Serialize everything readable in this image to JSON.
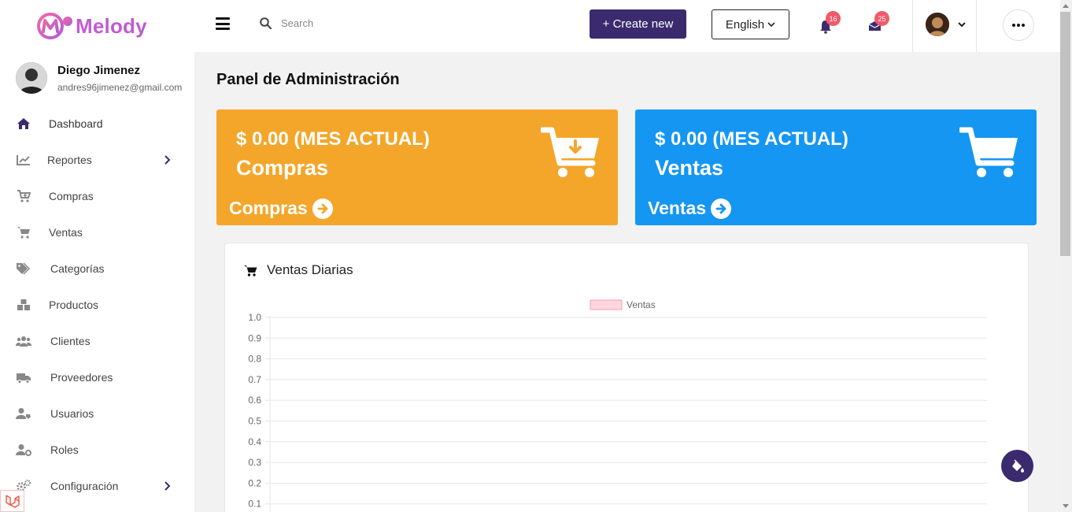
{
  "brand": {
    "name": "Melody"
  },
  "user": {
    "name": "Diego Jimenez",
    "email": "andres96jimenez@gmail.com"
  },
  "sidebar": {
    "items": [
      {
        "label": "Dashboard",
        "icon": "home-icon",
        "submenu": false,
        "active": true
      },
      {
        "label": "Reportes",
        "icon": "chart-line-icon",
        "submenu": true
      },
      {
        "label": "Compras",
        "icon": "cart-plus-icon",
        "submenu": false
      },
      {
        "label": "Ventas",
        "icon": "cart-icon",
        "submenu": false
      },
      {
        "label": "Categorías",
        "icon": "tags-icon",
        "submenu": false
      },
      {
        "label": "Productos",
        "icon": "boxes-icon",
        "submenu": false
      },
      {
        "label": "Clientes",
        "icon": "users-icon",
        "submenu": false
      },
      {
        "label": "Proveedores",
        "icon": "truck-icon",
        "submenu": false
      },
      {
        "label": "Usuarios",
        "icon": "user-tag-icon",
        "submenu": false
      },
      {
        "label": "Roles",
        "icon": "user-cog-icon",
        "submenu": false
      },
      {
        "label": "Configuración",
        "icon": "cogs-icon",
        "submenu": true
      }
    ]
  },
  "topbar": {
    "search_placeholder": "Search",
    "create_label": "+ Create new",
    "language": "English",
    "notifications_count": "16",
    "messages_count": "25"
  },
  "main": {
    "title": "Panel de Administración",
    "cards": [
      {
        "amount": "$ 0.00 (MES ACTUAL)",
        "title": "Compras",
        "link": "Compras",
        "color": "#f4a62a",
        "icon": "cart-download-icon"
      },
      {
        "amount": "$ 0.00 (MES ACTUAL)",
        "title": "Ventas",
        "link": "Ventas",
        "color": "#1496f2",
        "icon": "cart-icon"
      }
    ],
    "panel_title": "Ventas Diarias"
  },
  "chart_data": {
    "type": "bar",
    "title": "",
    "series": [
      {
        "name": "Ventas",
        "values": []
      }
    ],
    "categories": [],
    "yticks": [
      "1.0",
      "0.9",
      "0.8",
      "0.7",
      "0.6",
      "0.5",
      "0.4",
      "0.3",
      "0.2",
      "0.1"
    ],
    "ylim": [
      0,
      1
    ],
    "grid": true,
    "legend": "top",
    "legend_fill": "#ffd6dc",
    "legend_stroke": "#f3a0ac"
  }
}
